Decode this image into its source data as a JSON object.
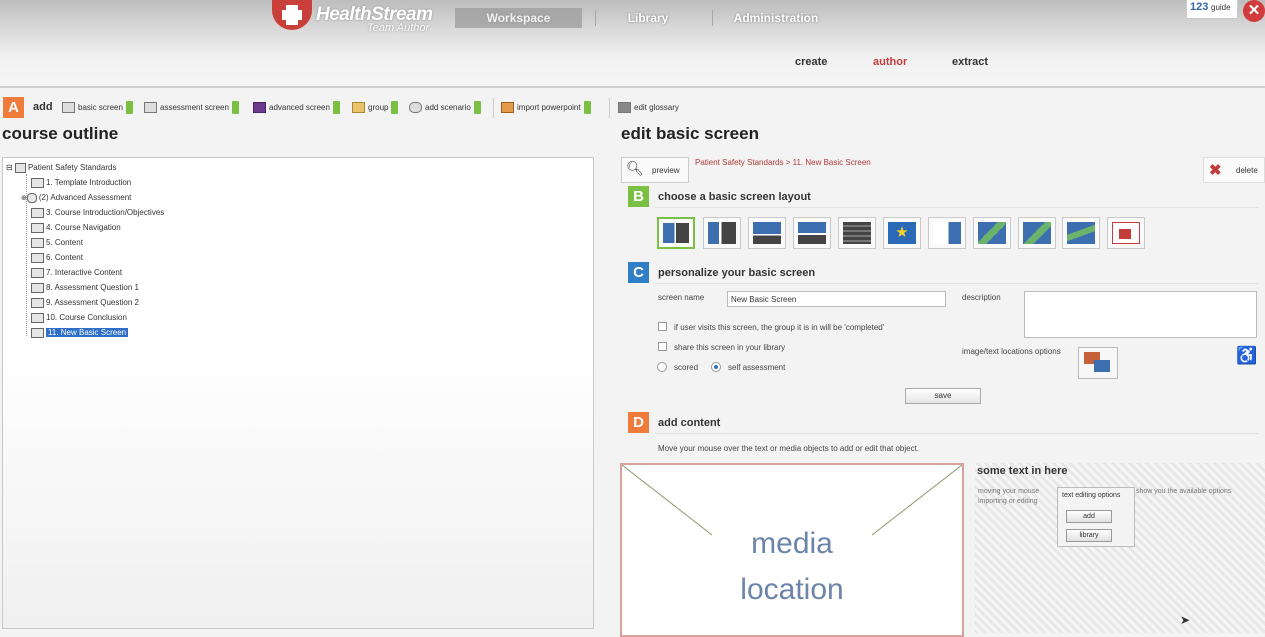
{
  "header": {
    "logo_name": "HealthStream",
    "logo_sub": "Team Author",
    "nav": [
      "Workspace",
      "Library",
      "Administration"
    ],
    "subnav": [
      "create",
      "author",
      "extract"
    ],
    "guide_number": "123",
    "guide_label": "guide"
  },
  "toolbar": {
    "letter": "A",
    "add_label": "add",
    "items": [
      "basic screen",
      "assessment screen",
      "advanced screen",
      "group",
      "add scenario",
      "import powerpoint",
      "edit glossary"
    ]
  },
  "outline": {
    "title": "course outline",
    "root": "Patient Safety Standards",
    "items": [
      "1. Template Introduction",
      "(2) Advanced Assessment",
      "3. Course Introduction/Objectives",
      "4. Course Navigation",
      "5. Content",
      "6. Content",
      "7. Interactive Content",
      "8. Assessment Question 1",
      "9. Assessment Question 2",
      "10. Course Conclusion",
      "11. New Basic Screen"
    ]
  },
  "editor": {
    "title": "edit basic screen",
    "preview_label": "preview",
    "breadcrumb": "Patient Safety Standards > 11. New Basic Screen",
    "delete_label": "delete",
    "section_b": {
      "letter": "B",
      "title": "choose a basic screen layout"
    },
    "section_c": {
      "letter": "C",
      "title": "personalize your basic screen",
      "screen_name_label": "screen name",
      "screen_name_value": "New Basic Screen",
      "description_label": "description",
      "check1": "if user visits this screen, the group it is in will be 'completed'",
      "check2": "share this screen in your library",
      "radio_scored": "scored",
      "radio_self": "self assessment",
      "image_options_label": "image/text locations options",
      "save_label": "save"
    },
    "section_d": {
      "letter": "D",
      "title": "add content",
      "instructions": "Move your mouse over the text or media objects to add or edit that object.",
      "media_line1": "media",
      "media_line2": "location",
      "text_heading": "some text in here",
      "text_hint_left": "moving your mouse",
      "text_hint_right": "show you the available options",
      "text_hint_line2": "importing or editing",
      "popup_title": "text editing options",
      "popup_add": "add",
      "popup_library": "library"
    }
  },
  "colors": {
    "accent_red": "#c43c3c",
    "green": "#7bc043",
    "orange": "#f07c3c",
    "blue": "#2f7ec6",
    "selection": "#2f6ec7"
  }
}
